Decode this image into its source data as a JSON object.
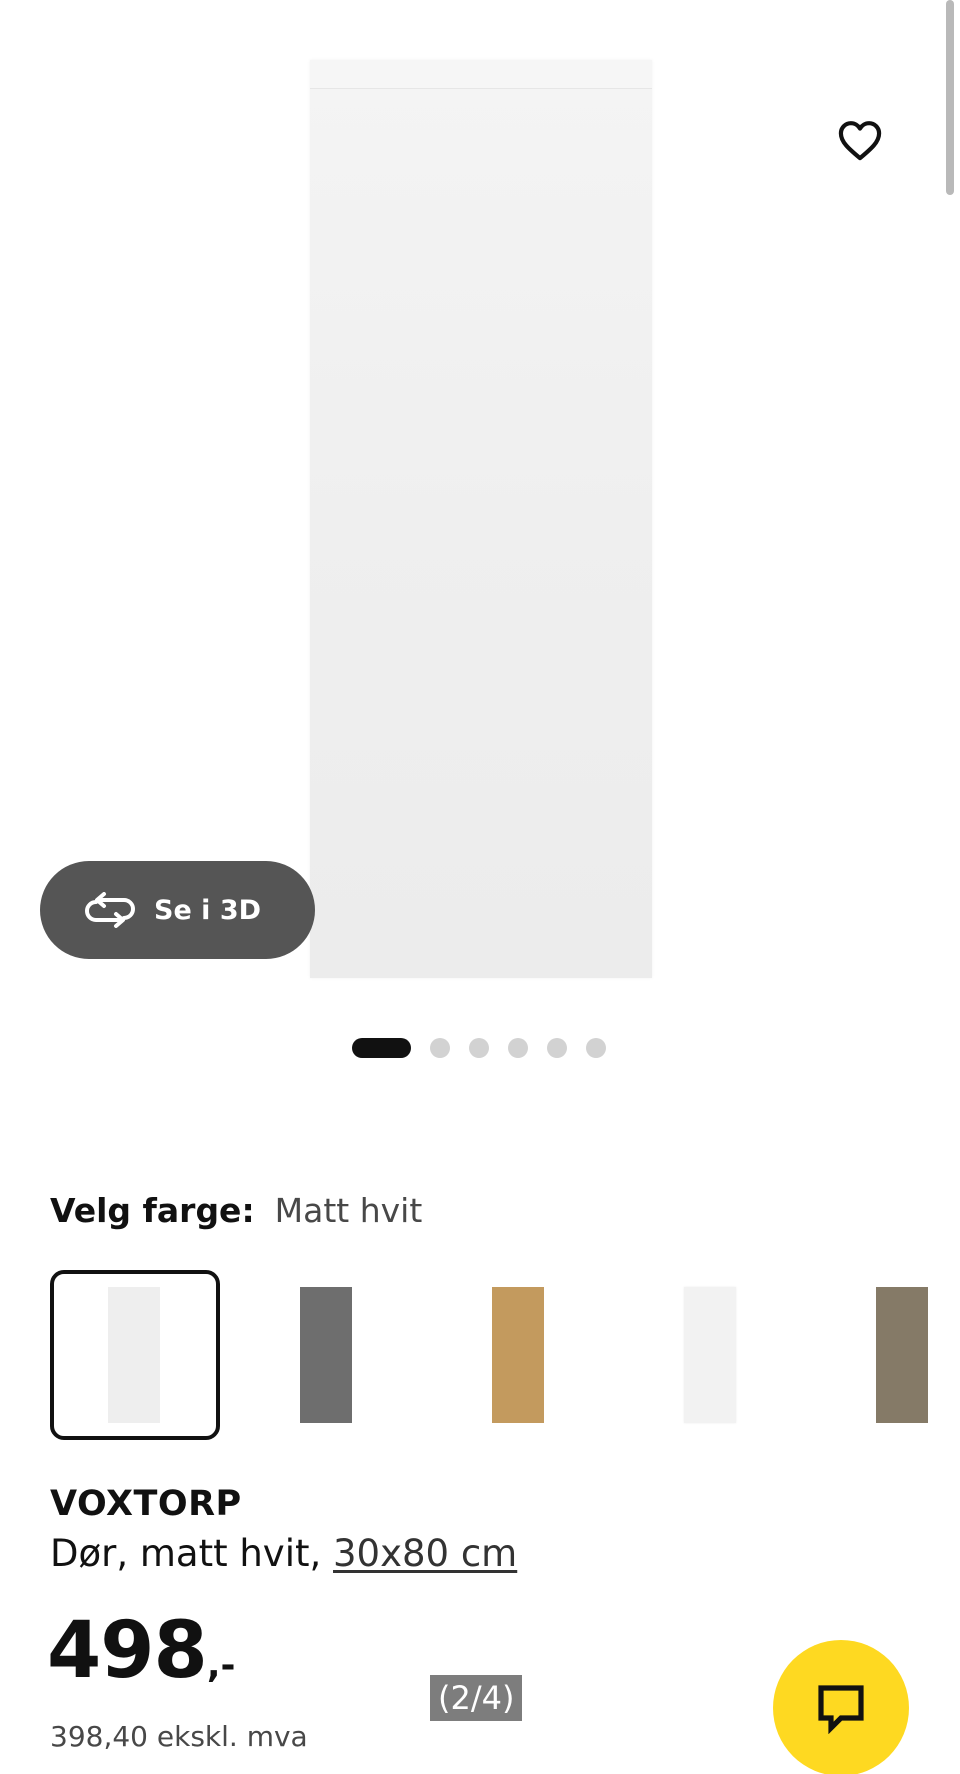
{
  "gallery": {
    "see_3d_label": "Se i 3D",
    "current_image": 1,
    "total_images": 6
  },
  "color_selector": {
    "label": "Velg farge:",
    "selected_value": "Matt hvit",
    "swatches": [
      {
        "color": "#eeeeee",
        "selected": true
      },
      {
        "color": "#6e6e6e",
        "selected": false
      },
      {
        "color": "#c39a5e",
        "selected": false
      },
      {
        "color": "#f2f2f2",
        "selected": false
      },
      {
        "color": "#857a67",
        "selected": false
      }
    ]
  },
  "product": {
    "name": "VOXTORP",
    "description_prefix": "Dør, matt hvit, ",
    "size_link": "30x80 cm",
    "price": "498",
    "price_suffix": ",-",
    "price_excl_vat": "398,40 ekskl. mva"
  },
  "overlay": {
    "page_counter": "(2/4)"
  },
  "colors": {
    "chat_button": "#fed921",
    "see_3d_button": "#555555",
    "active_dot": "#111111",
    "inactive_dot": "#d2d2d2"
  },
  "icons": {
    "favorite": "heart-outline-icon",
    "see_3d": "rotate-icon",
    "chat": "chat-bubble-icon"
  }
}
